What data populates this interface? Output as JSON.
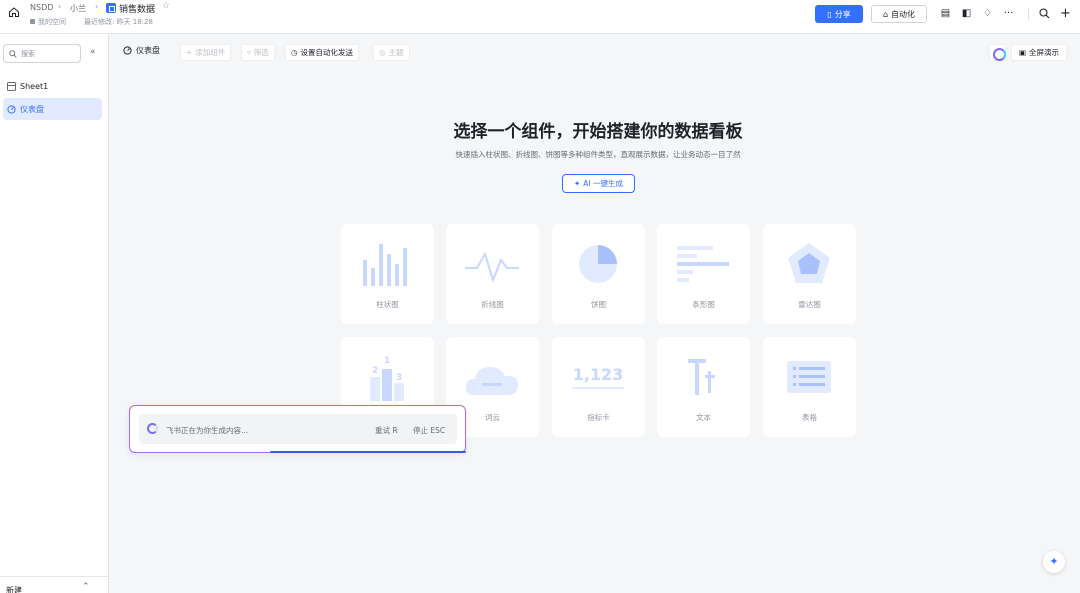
{
  "breadcrumb": {
    "workspace": "NSDD",
    "folder": "小兰",
    "doc_title": "销售数据",
    "subline_space": "我的空间",
    "subline_modified": "最近修改: 昨天 18:28"
  },
  "header": {
    "share_label": "分享",
    "automation_label": "自动化"
  },
  "sidebar": {
    "search_placeholder": "搜索",
    "items": [
      {
        "label": "Sheet1"
      },
      {
        "label": "仪表盘"
      }
    ],
    "footer_label": "新建"
  },
  "toolbar": {
    "dashboard_label": "仪表盘",
    "add_component": "添加组件",
    "filter": "筛选",
    "auto_send": "设置自动化发送",
    "theme": "主题",
    "fullscreen": "全屏演示"
  },
  "hero": {
    "title": "选择一个组件，开始搭建你的数据看板",
    "subtitle": "快速插入柱状图、折线图、饼图等多种组件类型，直观展示数据，让业务动态一目了然",
    "ai_button": "AI 一键生成"
  },
  "components": [
    {
      "label": "柱状图",
      "icon": "bar-chart-icon"
    },
    {
      "label": "折线图",
      "icon": "line-chart-icon"
    },
    {
      "label": "饼图",
      "icon": "pie-chart-icon"
    },
    {
      "label": "条形图",
      "icon": "horizontal-bar-icon"
    },
    {
      "label": "雷达图",
      "icon": "radar-chart-icon"
    },
    {
      "label": "",
      "icon": "ranking-icon"
    },
    {
      "label": "词云",
      "icon": "word-cloud-icon"
    },
    {
      "label": "指标卡",
      "icon": "metric-card-icon"
    },
    {
      "label": "文本",
      "icon": "text-icon"
    },
    {
      "label": "表格",
      "icon": "table-icon"
    }
  ],
  "metric_sample": "1,123",
  "ranking_numbers": [
    "1",
    "2",
    "3"
  ],
  "ai_popup": {
    "status": "飞书正在为你生成内容...",
    "retry": "重试 R",
    "stop": "停止 ESC"
  },
  "colors": {
    "accent": "#3370ff",
    "icon_fill": "#c7d7fd",
    "popup_border": "#a66ee8"
  }
}
